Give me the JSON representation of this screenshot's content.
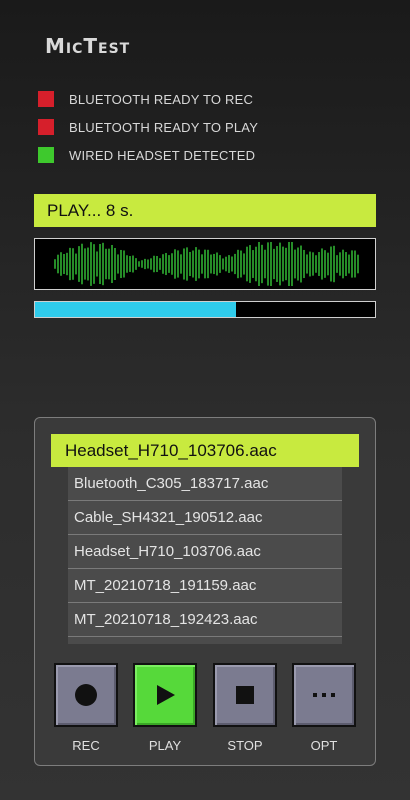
{
  "app": {
    "title": "MicTest"
  },
  "status": [
    {
      "label": "BLUETOOTH READY TO REC",
      "color": "#d61f2b"
    },
    {
      "label": "BLUETOOTH READY TO PLAY",
      "color": "#d61f2b"
    },
    {
      "label": "WIRED HEADSET DETECTED",
      "color": "#3ec92d"
    }
  ],
  "player": {
    "status_text": "PLAY... 8 s.",
    "progress_fraction": 0.59
  },
  "files": {
    "selected": "Headset_H710_103706.aac",
    "items": [
      "Bluetooth_C305_183717.aac",
      "Cable_SH4321_190512.aac",
      "Headset_H710_103706.aac",
      "MT_20210718_191159.aac",
      "MT_20210718_192423.aac"
    ]
  },
  "controls": {
    "rec_label": "REC",
    "play_label": "PLAY",
    "stop_label": "STOP",
    "opt_label": "OPT"
  },
  "colors": {
    "accent": "#c8ea3f",
    "progress": "#2fcbeb",
    "waveform": "#36c83a"
  }
}
